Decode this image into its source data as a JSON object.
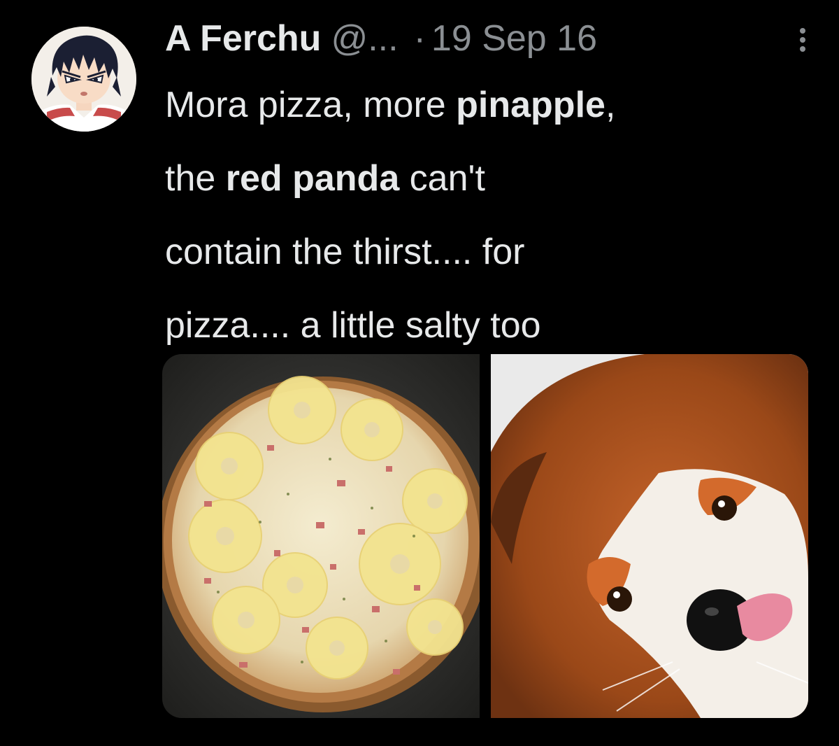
{
  "tweet": {
    "author": {
      "display_name": "A Ferchu",
      "handle": "@...",
      "avatar_icon": "anime-avatar-icon"
    },
    "separator": "·",
    "date": "19 Sep 16",
    "more_icon": "more-vertical-icon",
    "text_lines": [
      [
        {
          "text": "Mora pizza, more ",
          "bold": false
        },
        {
          "text": "pinapple",
          "bold": true
        },
        {
          "text": ",",
          "bold": false
        }
      ],
      [
        {
          "text": "the ",
          "bold": false
        },
        {
          "text": "red panda",
          "bold": true
        },
        {
          "text": " can't",
          "bold": false
        }
      ],
      [
        {
          "text": "contain the thirst.... for",
          "bold": false
        }
      ],
      [
        {
          "text": "pizza.... a little salty too",
          "bold": false
        }
      ]
    ],
    "media": [
      {
        "name": "pineapple-pizza-photo"
      },
      {
        "name": "red-panda-photo"
      }
    ]
  },
  "colors": {
    "background": "#000000",
    "primary_text": "#e7e9ea",
    "secondary_text": "#8b8f93"
  }
}
